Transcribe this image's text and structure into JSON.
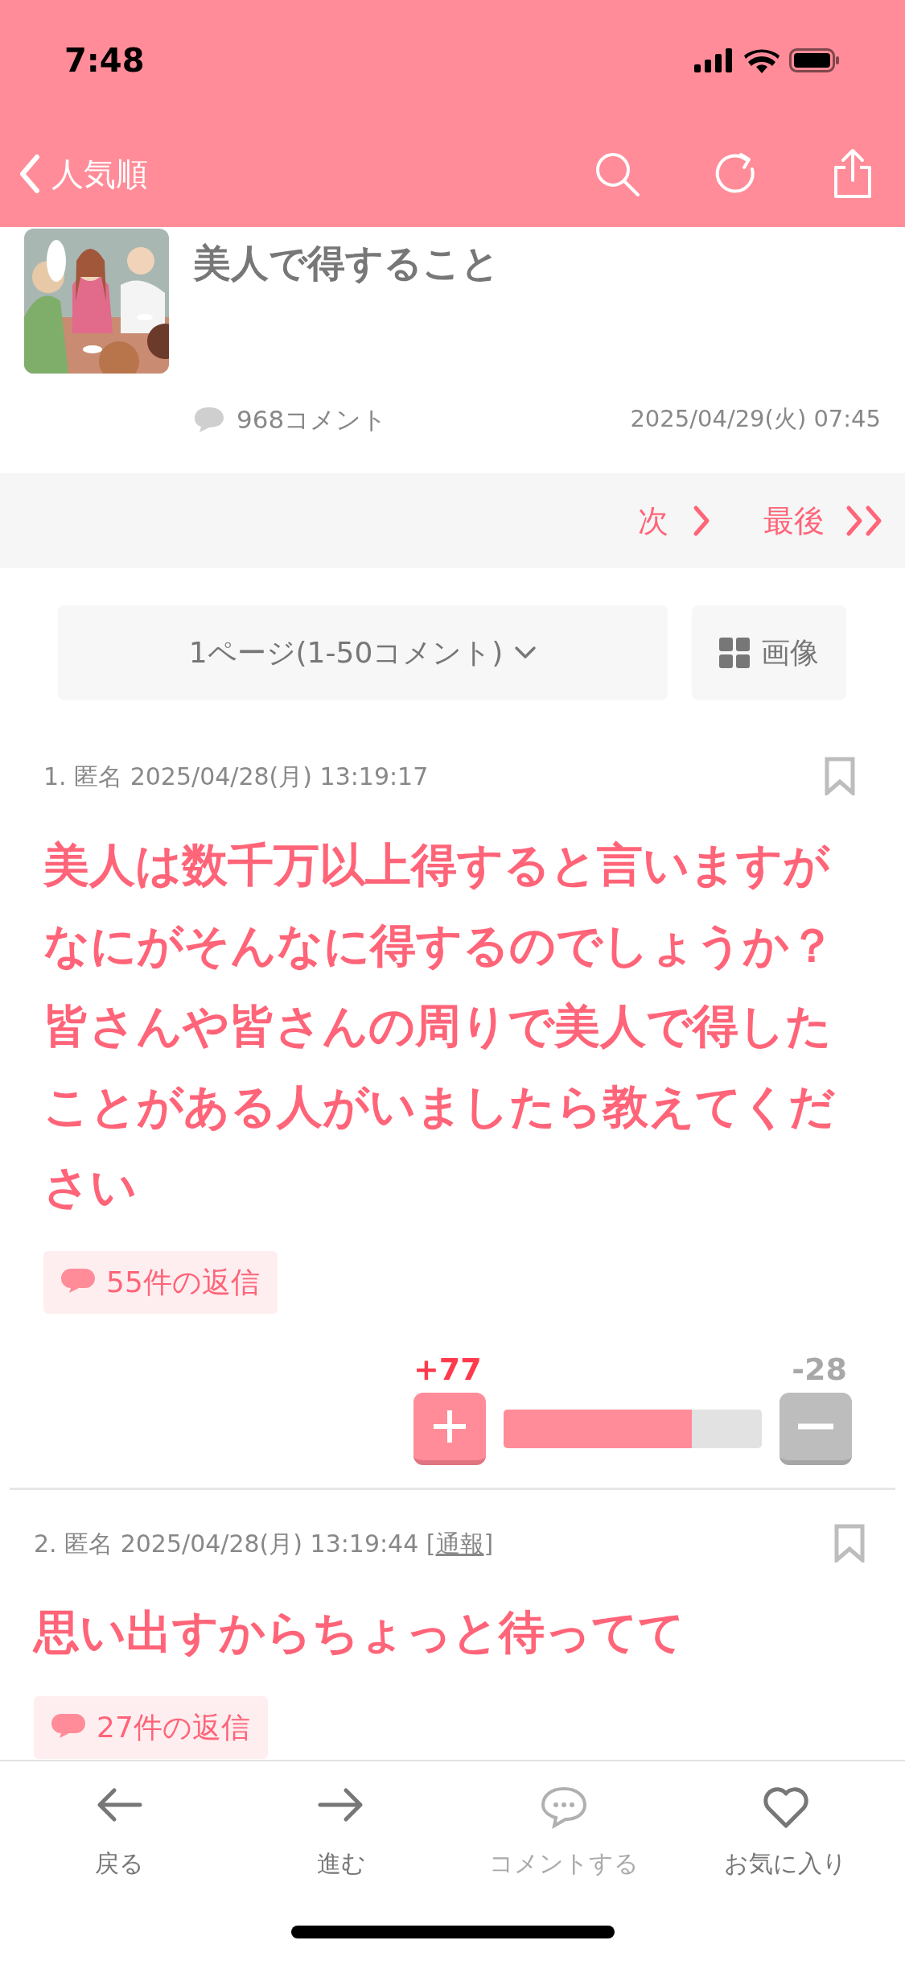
{
  "status_bar": {
    "time": "7:48"
  },
  "nav": {
    "back_label": "人気順"
  },
  "topic": {
    "kind": "picture",
    "title": "美人で得すること",
    "comment_count": "968コメント",
    "date": "2025/04/29(火) 07:45"
  },
  "pager": {
    "next": "次",
    "last": "最後",
    "page_select": "1ページ(1-50コメント)",
    "images": "画像"
  },
  "comments": [
    {
      "meta": "1. 匿名 2025/04/28(月) 13:19:17",
      "bookmarked": false,
      "body": "美人は数千万以上得すると言いますがなにがそんなに得するのでしょうか？皆さんや皆さんの周りで美人で得したことがある人がいましたら教えてください",
      "replies": "55件の返信",
      "plus": "+77",
      "minus": "-28",
      "level": 0.73
    },
    {
      "meta": "2. 匿名 2025/04/28(月) 13:19:44 [",
      "report": "通報",
      "meta_end": "]",
      "bookmarked": false,
      "body": "思い出すからちょっと待ってて",
      "replies": "27件の返信"
    }
  ],
  "bottom_bar": [
    {
      "kind": "back",
      "label": "戻る",
      "disabled": false
    },
    {
      "kind": "forward",
      "label": "進む",
      "disabled": false
    },
    {
      "kind": "comment",
      "label": "コメントする",
      "disabled": true
    },
    {
      "kind": "favorite",
      "label": "お気に入り",
      "disabled": false
    }
  ]
}
